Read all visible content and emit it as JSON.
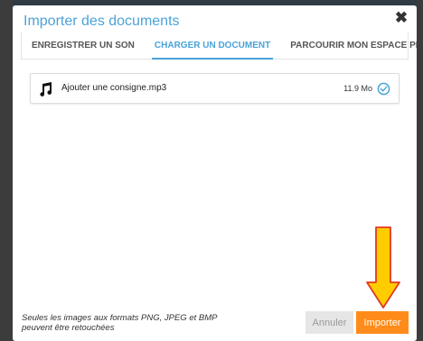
{
  "modal": {
    "title": "Importer des documents",
    "close_glyph": "✖"
  },
  "tabs": [
    {
      "label": "ENREGISTRER UN SON",
      "active": false
    },
    {
      "label": "CHARGER UN DOCUMENT",
      "active": true
    },
    {
      "label": "PARCOURIR MON ESPACE PERSONNEL",
      "active": false
    }
  ],
  "files": [
    {
      "name": "Ajouter une consigne.mp3",
      "size": "11.9 Mo",
      "icon": "music-note-icon",
      "status_icon": "check-circle-icon"
    }
  ],
  "footer": {
    "hint_line1": "Seules les images aux formats PNG, JPEG et BMP",
    "hint_line2": "peuvent être retouchées",
    "cancel_label": "Annuler",
    "import_label": "Importer"
  },
  "colors": {
    "accent": "#4aa3d8",
    "import_button": "#ff8c1a",
    "check": "#4aa3d8",
    "arrow_fill": "#ffcc00",
    "arrow_stroke": "#e03a1e"
  }
}
